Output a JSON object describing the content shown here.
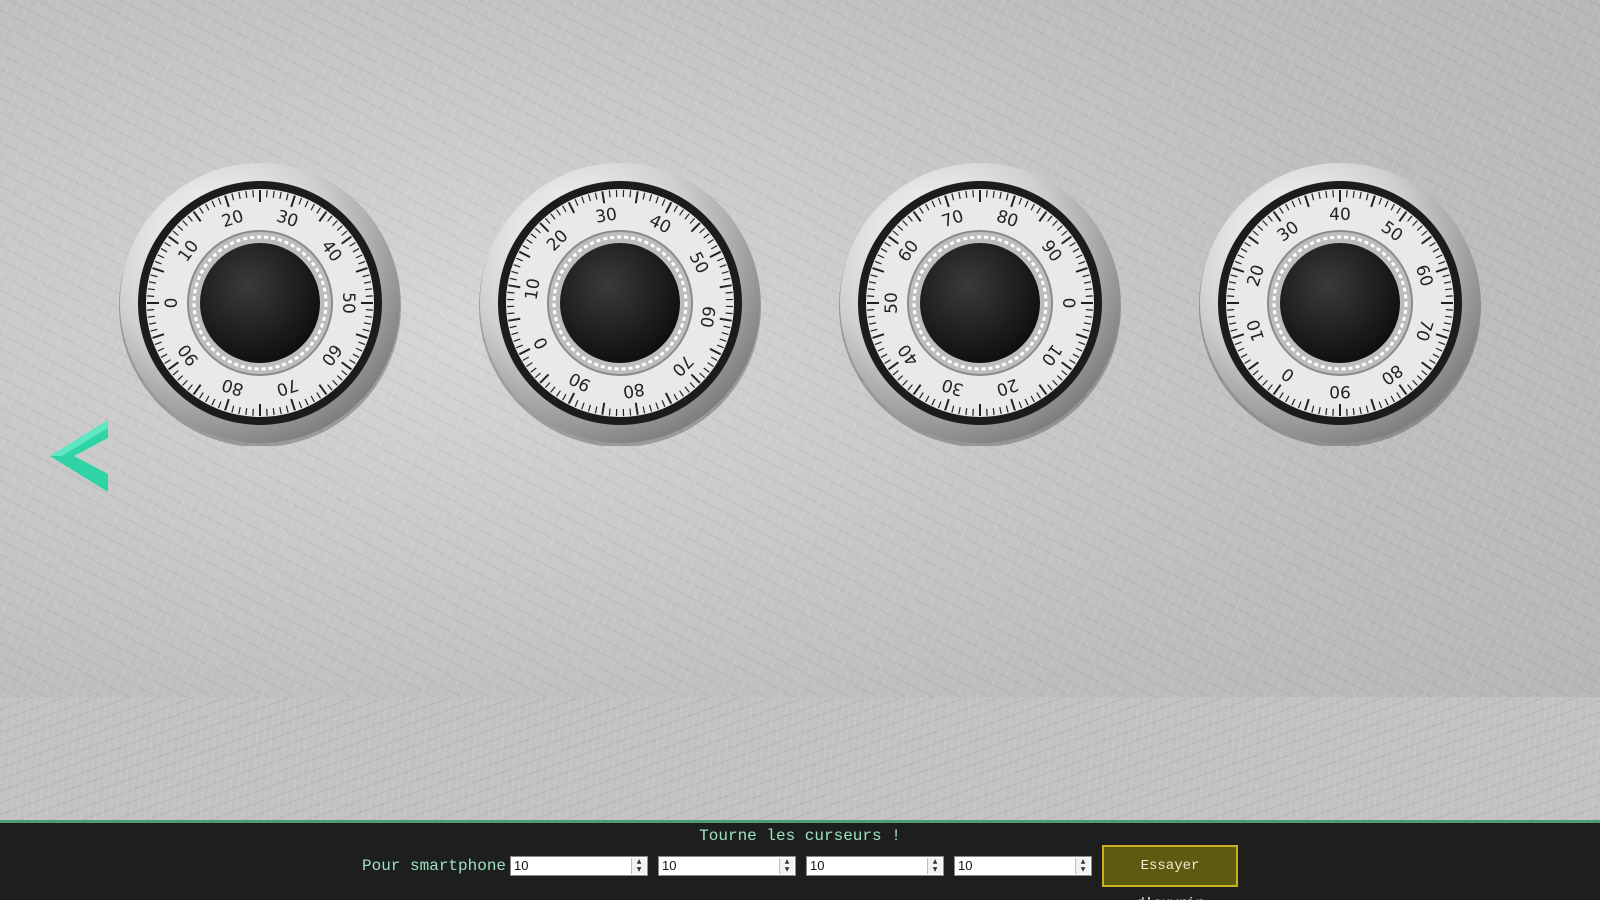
{
  "dials": [
    {
      "labels": [
        "0",
        "10",
        "20",
        "30",
        "40",
        "50",
        "60",
        "70",
        "80",
        "90"
      ],
      "rotation_deg": -90
    },
    {
      "labels": [
        "0",
        "10",
        "20",
        "30",
        "40",
        "50",
        "60",
        "70",
        "80",
        "90"
      ],
      "rotation_deg": -117
    },
    {
      "labels": [
        "0",
        "10",
        "20",
        "30",
        "40",
        "50",
        "60",
        "70",
        "80",
        "90"
      ],
      "rotation_deg": 90
    },
    {
      "labels": [
        "0",
        "10",
        "20",
        "30",
        "40",
        "50",
        "60",
        "70",
        "80",
        "90"
      ],
      "rotation_deg": -144
    }
  ],
  "nav": {
    "back_icon": "chevron-left-icon",
    "accent": "#2fd3a6"
  },
  "footer": {
    "title": "Tourne les curseurs !",
    "smartphone_label": "Pour smartphone :",
    "inputs": [
      "10",
      "10",
      "10",
      "10"
    ],
    "open_button": "Essayer d'ouvrir",
    "colors": {
      "bar": "#1d1f1e",
      "text": "#9fe0c0",
      "button_bg": "#5d5a12",
      "button_border": "#c9b020"
    }
  }
}
